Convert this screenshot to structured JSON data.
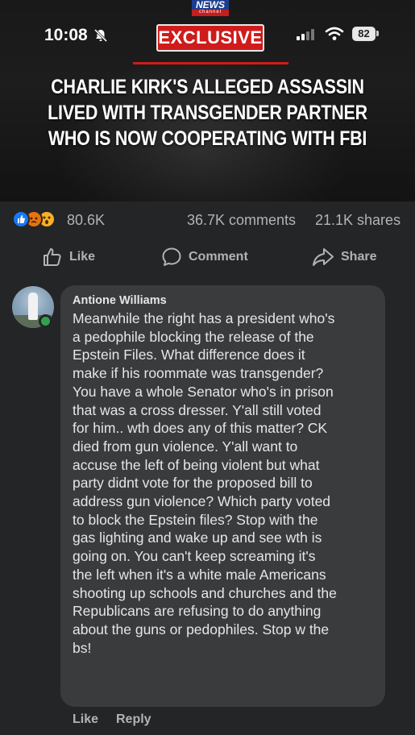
{
  "status_bar": {
    "time": "10:08",
    "battery": "82"
  },
  "post_image": {
    "logo_line1": "NEWS",
    "logo_line2": "channel",
    "badge": "EXCLUSIVE",
    "headline_lines": [
      "CHARLIE KIRK'S ALLEGED ASSASSIN",
      "LIVED WITH TRANSGENDER PARTNER",
      "WHO IS NOW COOPERATING WITH FBI"
    ]
  },
  "engagement": {
    "reactions": [
      "like",
      "angry",
      "wow"
    ],
    "reaction_count": "80.6K",
    "comments": "36.7K comments",
    "shares": "21.1K shares"
  },
  "actions": {
    "like": "Like",
    "comment": "Comment",
    "share": "Share"
  },
  "comment": {
    "author": "Antione Williams",
    "lines": [
      "Meanwhile the right has a president who's",
      "a pedophile blocking the release of the",
      "Epstein Files.  What difference does it",
      "make if his roommate was transgender?",
      "You have a whole Senator who's in prison",
      "that was a cross dresser.  Y'all still voted",
      "for him.. wth does any of this matter? CK",
      "died from gun violence.  Y'all want to",
      "accuse the left of being violent but what",
      "party didnt vote for the proposed bill to",
      "address gun violence? Which party voted",
      "to block the Epstein files?  Stop with the",
      "gas lighting and wake up and see wth is",
      "going on.  You can't keep screaming it's",
      "the left when it's a white male Americans",
      "shooting up schools and churches and the",
      "Republicans are refusing to do anything",
      "about the guns or pedophiles.  Stop w the",
      "bs!"
    ],
    "like_label": "Like",
    "reply_label": "Reply"
  },
  "colors": {
    "background": "#242526",
    "bubble": "#3a3b3c",
    "badge_red": "#cf1b1b",
    "online_green": "#31a24c"
  }
}
